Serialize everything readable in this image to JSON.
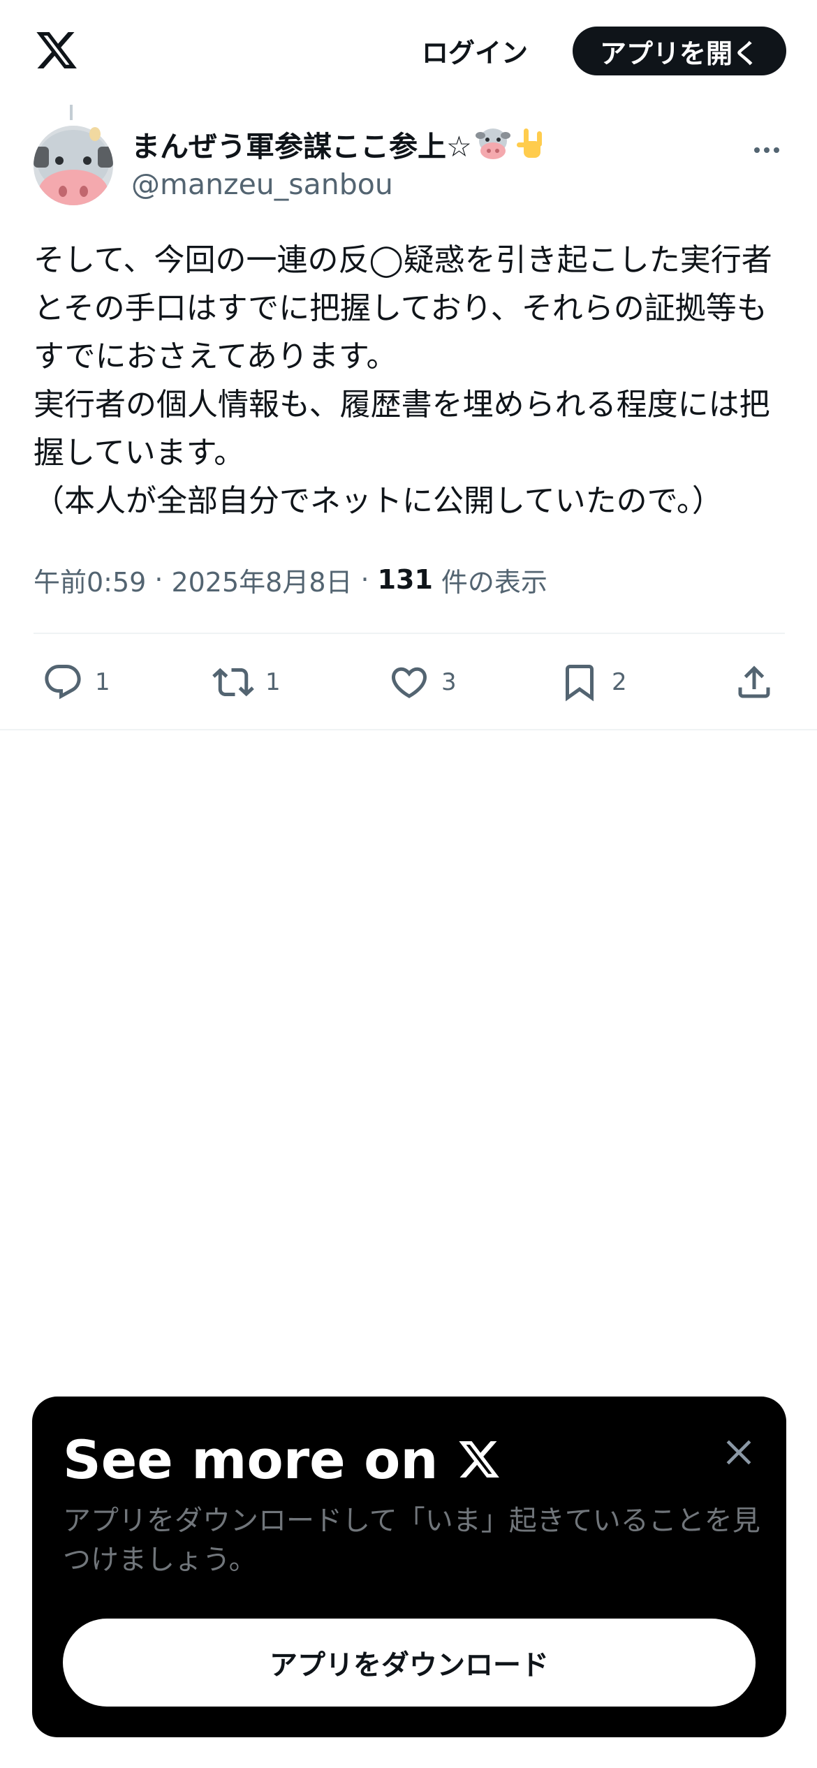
{
  "header": {
    "logo_icon": "x-logo-icon",
    "login_label": "ログイン",
    "open_app_label": "アプリを開く"
  },
  "author": {
    "display_name": "まんぜう軍参謀ここ参上☆",
    "name_emojis": [
      "cow-face-icon",
      "love-you-gesture-icon"
    ],
    "handle": "@manzeu_sanbou",
    "avatar_icon": "cow-avatar"
  },
  "tweet": {
    "text": "そして、今回の一連の反◯疑惑を引き起こした実行者とその手口はすでに把握しており、それらの証拠等もすでにおさえてあります。\n実行者の個人情報も、履歴書を埋められる程度には把握しています。\n（本人が全部自分でネットに公開していたので。）",
    "time": "午前0:59",
    "separator": "·",
    "date": "2025年8月8日",
    "views_count": "131",
    "views_label": "件の表示"
  },
  "actions": {
    "reply_count": "1",
    "retweet_count": "1",
    "like_count": "3",
    "bookmark_count": "2"
  },
  "promo": {
    "title": "See more on",
    "description": "アプリをダウンロードして「いま」起きていることを見つけましょう。",
    "download_label": "アプリをダウンロード"
  },
  "colors": {
    "text_primary": "#0f1419",
    "text_secondary": "#536471",
    "divider": "#eff3f4",
    "promo_bg": "#000000",
    "promo_text_secondary": "#71767b"
  }
}
